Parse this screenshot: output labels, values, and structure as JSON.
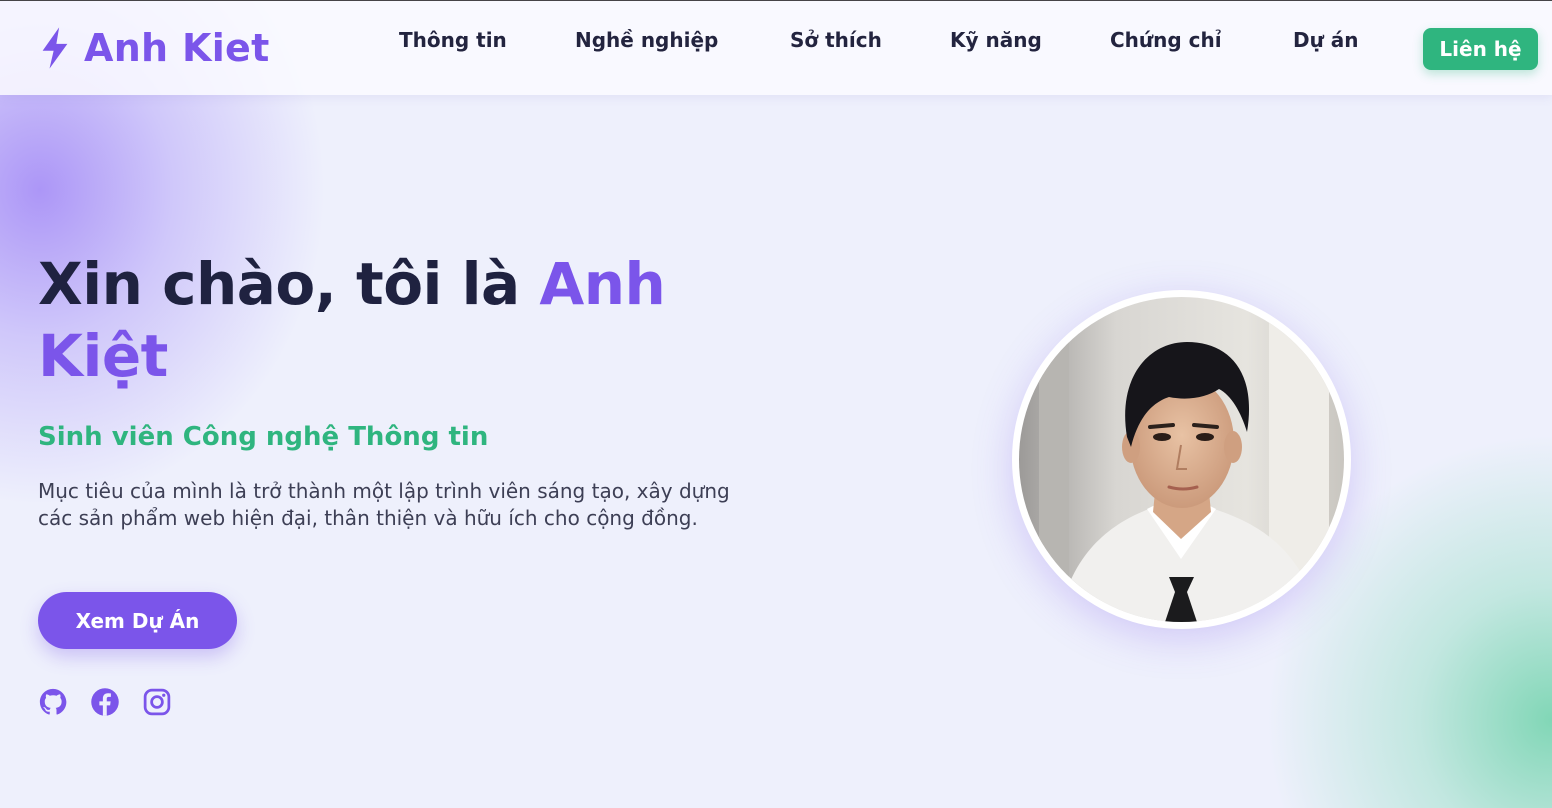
{
  "brand": {
    "name": "Anh Kiet",
    "icon": "bolt-icon"
  },
  "nav": {
    "items": [
      {
        "label": "Thông tin"
      },
      {
        "label": "Nghề nghiệp"
      },
      {
        "label": "Sở thích"
      },
      {
        "label": "Kỹ năng"
      },
      {
        "label": "Chứng chỉ"
      },
      {
        "label": "Dự án"
      }
    ],
    "contact_label": "Liên hệ"
  },
  "hero": {
    "greeting": "Xin chào, tôi là ",
    "name": "Anh Kiệt",
    "subtitle": "Sinh viên Công nghệ Thông tin",
    "description": "Mục tiêu của mình là trở thành một lập trình viên sáng tạo, xây dựng các sản phẩm web hiện đại, thân thiện và hữu ích cho cộng đồng.",
    "cta_label": "Xem Dự Án"
  },
  "socials": [
    {
      "icon": "github-icon"
    },
    {
      "icon": "facebook-icon"
    },
    {
      "icon": "instagram-icon"
    }
  ],
  "colors": {
    "accent": "#7b55ea",
    "green": "#2fb57f",
    "text": "#1f2240"
  }
}
